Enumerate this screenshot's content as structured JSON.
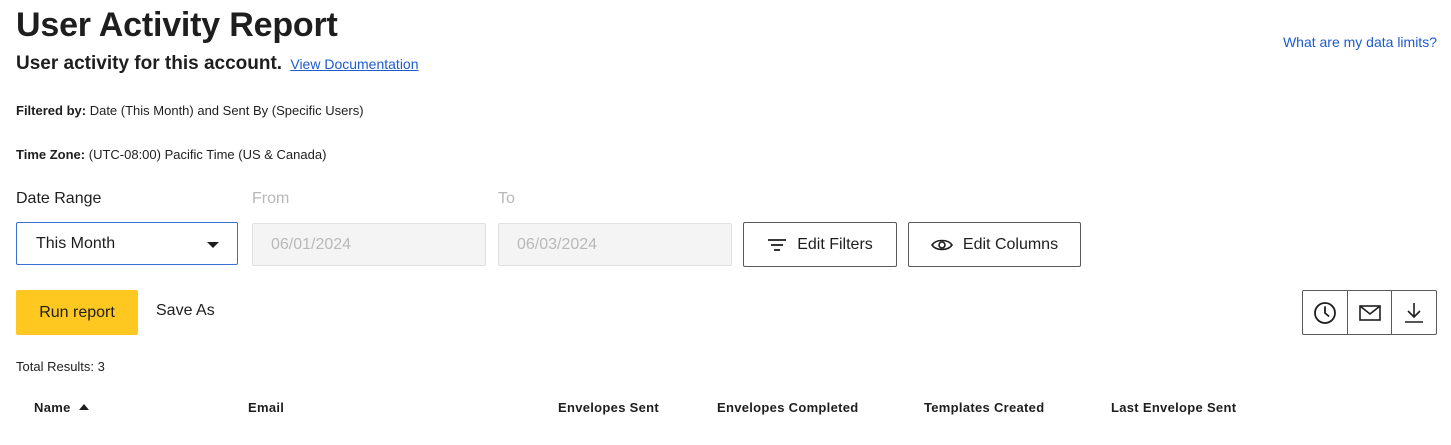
{
  "header": {
    "title": "User Activity Report",
    "subtitle": "User activity for this account.",
    "doc_link": "View Documentation",
    "limits_link": "What are my data limits?"
  },
  "filters": {
    "filtered_by_label": "Filtered by:",
    "filtered_by_value": "Date (This Month) and Sent By (Specific Users)",
    "timezone_label": "Time Zone:",
    "timezone_value": "(UTC-08:00) Pacific Time (US & Canada)"
  },
  "date_range": {
    "label": "Date Range",
    "selected": "This Month",
    "from_label": "From",
    "from_placeholder": "06/01/2024",
    "to_label": "To",
    "to_placeholder": "06/03/2024"
  },
  "buttons": {
    "edit_filters": "Edit Filters",
    "edit_columns": "Edit Columns",
    "run_report": "Run report",
    "save_as": "Save As"
  },
  "icons": {
    "schedule": "clock-icon",
    "email": "envelope-icon",
    "download": "download-icon",
    "filters": "filter-lines-icon",
    "columns": "eye-icon"
  },
  "results": {
    "total": "Total Results: 3"
  },
  "table": {
    "columns": [
      "Name",
      "Email",
      "Envelopes Sent",
      "Envelopes Completed",
      "Templates Created",
      "Last Envelope Sent"
    ]
  },
  "colors": {
    "accent_yellow": "#ffc820",
    "link_blue": "#1d5bd1",
    "select_border": "#3b6fd4"
  }
}
